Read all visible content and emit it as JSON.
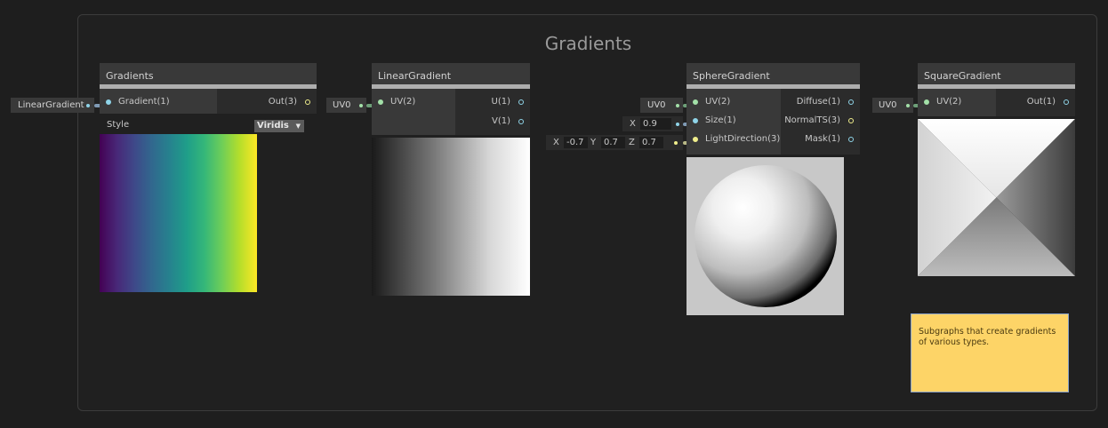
{
  "group": {
    "title": "Gradients"
  },
  "nodes": {
    "gradients": {
      "title": "Gradients",
      "input": "Gradient(1)",
      "output": "Out(3)",
      "style_label": "Style",
      "style_value": "Viridis",
      "dropdown_arrow": "▼",
      "connected_property": "LinearGradient"
    },
    "linear": {
      "title": "LinearGradient",
      "input": "UV(2)",
      "outputs": [
        "U(1)",
        "V(1)"
      ],
      "input_value": "UV0"
    },
    "sphere": {
      "title": "SphereGradient",
      "inputs": [
        "UV(2)",
        "Size(1)",
        "LightDirection(3)"
      ],
      "outputs": [
        "Diffuse(1)",
        "NormalTS(3)",
        "Mask(1)"
      ],
      "uv_value": "UV0",
      "size": {
        "label": "X",
        "value": "0.9"
      },
      "light_direction": {
        "x_label": "X",
        "x": "-0.7",
        "y_label": "Y",
        "y": "0.7",
        "z_label": "Z",
        "z": "0.7"
      }
    },
    "square": {
      "title": "SquareGradient",
      "input": "UV(2)",
      "output": "Out(1)",
      "input_value": "UV0"
    }
  },
  "sticky_note": {
    "text": "Subgraphs that create gradients of various types."
  },
  "colors": {
    "background": "#1e1e1e",
    "node_header": "#393939",
    "port_cyan": "#8fd4e8",
    "port_yellow": "#f0ee8c",
    "wire_green": "#6d9f78",
    "sticky": "#fdd467"
  }
}
